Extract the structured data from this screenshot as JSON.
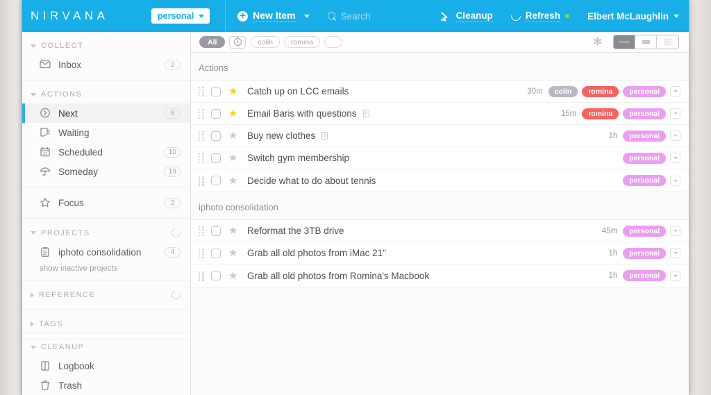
{
  "topbar": {
    "brand": "NIRVANA",
    "workspace": "personal",
    "new_item": "New Item",
    "search_placeholder": "Search",
    "cleanup": "Cleanup",
    "refresh": "Refresh",
    "user": "Elbert McLaughlin",
    "accent_color": "#18aee8",
    "status_dot_color": "#8ddc2a"
  },
  "sidebar": {
    "groups": [
      {
        "label": "COLLECT",
        "collapsed": false,
        "has_spinner": false,
        "items": [
          {
            "label": "Inbox",
            "count": "2",
            "icon": "inbox-icon",
            "active": false
          }
        ]
      },
      {
        "label": "ACTIONS",
        "collapsed": false,
        "has_spinner": false,
        "items": [
          {
            "label": "Next",
            "count": "8",
            "icon": "next-arrow-icon",
            "active": true
          },
          {
            "label": "Waiting",
            "count": "",
            "icon": "waiting-icon",
            "active": false
          },
          {
            "label": "Scheduled",
            "count": "10",
            "icon": "calendar-icon",
            "active": false
          },
          {
            "label": "Someday",
            "count": "19",
            "icon": "umbrella-icon",
            "active": false
          }
        ]
      },
      {
        "label": "",
        "collapsed": false,
        "has_spinner": false,
        "items": [
          {
            "label": "Focus",
            "count": "2",
            "icon": "star-outline-icon",
            "active": false
          }
        ]
      },
      {
        "label": "PROJECTS",
        "collapsed": false,
        "has_spinner": true,
        "sublink": "show inactive projects",
        "items": [
          {
            "label": "iphoto consolidation",
            "count": "4",
            "icon": "clipboard-icon",
            "active": false
          }
        ]
      },
      {
        "label": "REFERENCE",
        "collapsed": true,
        "has_spinner": true,
        "items": []
      },
      {
        "label": "TAGS",
        "collapsed": true,
        "has_spinner": false,
        "items": []
      }
    ],
    "bottom_group": {
      "label": "CLEANUP",
      "collapsed": false,
      "items": [
        {
          "label": "Logbook",
          "count": "",
          "icon": "logbook-icon",
          "active": false
        },
        {
          "label": "Trash",
          "count": "",
          "icon": "trash-icon",
          "active": false
        }
      ]
    }
  },
  "filterbar": {
    "chips": [
      {
        "label": "All",
        "type": "text",
        "active": true
      },
      {
        "label": "",
        "type": "clock-icon",
        "active": false
      },
      {
        "label": "colin",
        "type": "text",
        "active": false
      },
      {
        "label": "romina",
        "type": "text",
        "active": false
      },
      {
        "label": "",
        "type": "empty",
        "active": false
      }
    ],
    "snowflake_icon": "snowflake-icon",
    "views": [
      {
        "name": "compact-view",
        "active": true
      },
      {
        "name": "medium-view",
        "active": false
      },
      {
        "name": "detailed-view",
        "active": false
      }
    ]
  },
  "main": {
    "sections": [
      {
        "title": "Actions",
        "tasks": [
          {
            "title": "Catch up on LCC emails",
            "starred": true,
            "has_note": false,
            "duration": "30m",
            "tags": [
              {
                "label": "colin",
                "color": "gray"
              },
              {
                "label": "romina",
                "color": "red"
              },
              {
                "label": "personal",
                "color": "pink"
              }
            ]
          },
          {
            "title": "Email Baris with questions",
            "starred": true,
            "has_note": true,
            "duration": "15m",
            "tags": [
              {
                "label": "romina",
                "color": "red"
              },
              {
                "label": "personal",
                "color": "pink"
              }
            ]
          },
          {
            "title": "Buy new clothes",
            "starred": false,
            "has_note": true,
            "duration": "1h",
            "tags": [
              {
                "label": "personal",
                "color": "pink"
              }
            ]
          },
          {
            "title": "Switch gym membership",
            "starred": false,
            "has_note": false,
            "duration": "",
            "tags": [
              {
                "label": "personal",
                "color": "pink"
              }
            ]
          },
          {
            "title": "Decide what to do about tennis",
            "starred": false,
            "has_note": false,
            "duration": "",
            "tags": [
              {
                "label": "personal",
                "color": "pink"
              }
            ]
          }
        ]
      },
      {
        "title": "iphoto consolidation",
        "tasks": [
          {
            "title": "Reformat the 3TB drive",
            "starred": false,
            "has_note": false,
            "duration": "45m",
            "tags": [
              {
                "label": "personal",
                "color": "pink"
              }
            ]
          },
          {
            "title": "Grab all old photos from iMac 21\"",
            "starred": false,
            "has_note": false,
            "duration": "1h",
            "tags": [
              {
                "label": "personal",
                "color": "pink"
              }
            ]
          },
          {
            "title": "Grab all old photos from Romina's Macbook",
            "starred": false,
            "has_note": false,
            "duration": "1h",
            "tags": [
              {
                "label": "personal",
                "color": "pink"
              }
            ]
          }
        ]
      }
    ]
  }
}
